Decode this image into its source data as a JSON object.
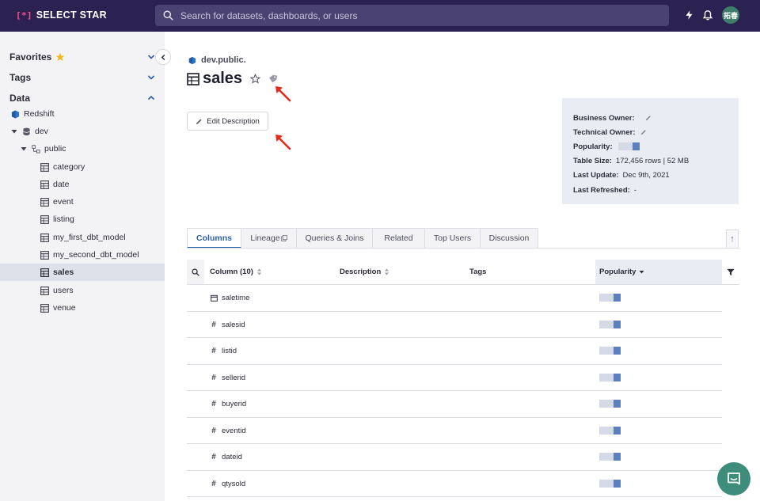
{
  "app": {
    "name": "SELECT STAR",
    "logo_mark": "[*]"
  },
  "search": {
    "placeholder": "Search for datasets, dashboards, or users"
  },
  "header": {
    "avatar_initials": "拓春"
  },
  "sidebar": {
    "sections": [
      {
        "label": "Favorites"
      },
      {
        "label": "Tags"
      },
      {
        "label": "Data"
      }
    ],
    "tree": [
      {
        "label": "Redshift",
        "icon": "redshift-icon"
      },
      {
        "label": "dev",
        "icon": "database-icon"
      },
      {
        "label": "public",
        "icon": "schema-icon"
      },
      {
        "label": "category",
        "icon": "table-icon"
      },
      {
        "label": "date",
        "icon": "table-icon"
      },
      {
        "label": "event",
        "icon": "table-icon"
      },
      {
        "label": "listing",
        "icon": "table-icon"
      },
      {
        "label": "my_first_dbt_model",
        "icon": "table-icon"
      },
      {
        "label": "my_second_dbt_model",
        "icon": "table-icon"
      },
      {
        "label": "sales",
        "icon": "table-icon",
        "selected": true
      },
      {
        "label": "users",
        "icon": "table-icon"
      },
      {
        "label": "venue",
        "icon": "table-icon"
      }
    ]
  },
  "page": {
    "breadcrumb": "dev.public.",
    "title": "sales",
    "edit_description_label": "Edit Description"
  },
  "meta": {
    "business_owner_label": "Business Owner:",
    "technical_owner_label": "Technical Owner:",
    "popularity_label": "Popularity:",
    "table_size_label": "Table Size:",
    "table_size_value": "172,456 rows | 52 MB",
    "last_update_label": "Last Update:",
    "last_update_value": "Dec 9th, 2021",
    "last_refreshed_label": "Last Refreshed:",
    "last_refreshed_value": "-"
  },
  "tabs": [
    {
      "label": "Columns",
      "active": true
    },
    {
      "label": "Lineage"
    },
    {
      "label": "Queries & Joins"
    },
    {
      "label": "Related"
    },
    {
      "label": "Top Users"
    },
    {
      "label": "Discussion"
    }
  ],
  "table": {
    "headers": {
      "column": "Column (10)",
      "description": "Description",
      "tags": "Tags",
      "popularity": "Popularity"
    },
    "rows": [
      {
        "name": "saletime",
        "type_icon": "calendar-icon"
      },
      {
        "name": "salesid",
        "type_icon": "#"
      },
      {
        "name": "listid",
        "type_icon": "#"
      },
      {
        "name": "sellerid",
        "type_icon": "#"
      },
      {
        "name": "buyerid",
        "type_icon": "#"
      },
      {
        "name": "eventid",
        "type_icon": "#"
      },
      {
        "name": "dateid",
        "type_icon": "#"
      },
      {
        "name": "qtysold",
        "type_icon": "#"
      }
    ]
  },
  "colors": {
    "topbar": "#2b2252",
    "accent": "#2b5ea8",
    "pop_light": "#d6dae6",
    "pop_dark": "#5b7fbf",
    "arrow": "#e8291c",
    "favorite_star": "#f5b81c"
  }
}
